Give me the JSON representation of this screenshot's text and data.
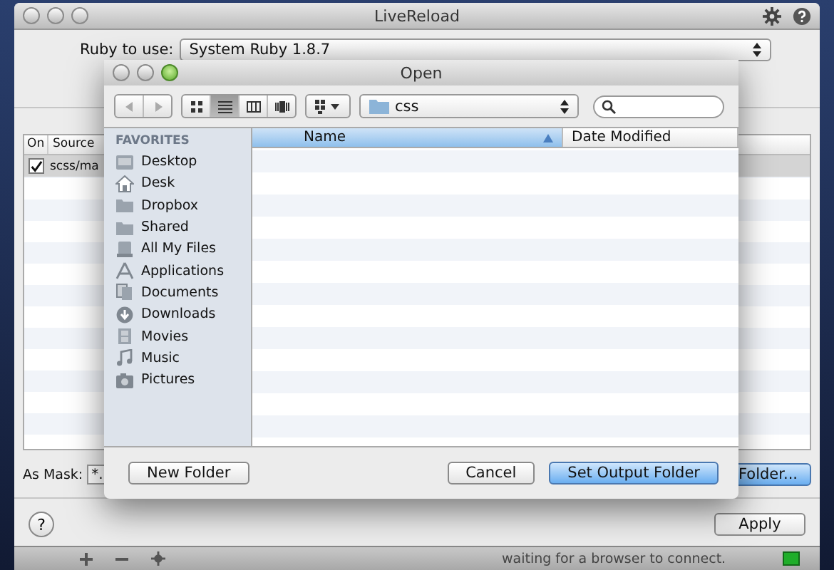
{
  "main_window": {
    "title": "LiveReload",
    "ruby_label": "Ruby to use:",
    "ruby_select": "System Ruby 1.8.7",
    "table": {
      "columns": [
        "On",
        "Source"
      ],
      "rows": [
        {
          "checked": true,
          "source": "scss/ma"
        }
      ]
    },
    "mask_label": "As Mask:",
    "mask_value": "*.",
    "folder_button": "Folder...",
    "help_button": "?",
    "apply_button": "Apply",
    "status": "waiting for a browser to connect."
  },
  "dialog": {
    "title": "Open",
    "view_modes": [
      {
        "kind": "icons",
        "selected": false
      },
      {
        "kind": "list",
        "selected": true
      },
      {
        "kind": "columns",
        "selected": false
      },
      {
        "kind": "coverflow",
        "selected": false
      }
    ],
    "path": "css",
    "sidebar": {
      "heading": "FAVORITES",
      "items": [
        {
          "label": "Desktop",
          "kind": "desktop"
        },
        {
          "label": "Desk",
          "kind": "home"
        },
        {
          "label": "Dropbox",
          "kind": "folder"
        },
        {
          "label": "Shared",
          "kind": "folder"
        },
        {
          "label": "All My Files",
          "kind": "files"
        },
        {
          "label": "Applications",
          "kind": "apps"
        },
        {
          "label": "Documents",
          "kind": "documents"
        },
        {
          "label": "Downloads",
          "kind": "downloads"
        },
        {
          "label": "Movies",
          "kind": "movies"
        },
        {
          "label": "Music",
          "kind": "music"
        },
        {
          "label": "Pictures",
          "kind": "pictures"
        }
      ]
    },
    "columns": [
      {
        "label": "Name",
        "sorted": true
      },
      {
        "label": "Date Modified",
        "sorted": false
      }
    ],
    "new_folder_button": "New Folder",
    "cancel_button": "Cancel",
    "confirm_button": "Set Output Folder"
  }
}
